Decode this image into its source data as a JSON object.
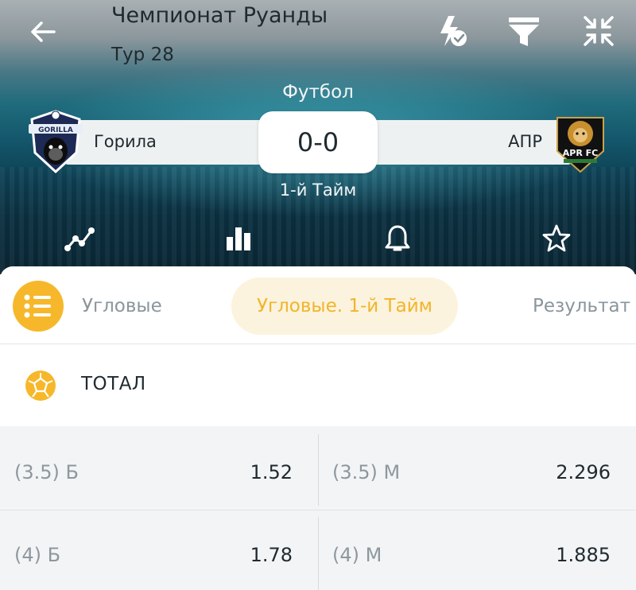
{
  "header": {
    "title": "Чемпионат Руанды",
    "subtitle": "Тур 28",
    "sport": "Футбол",
    "period": "1-й Тайм",
    "score": "0-0",
    "home_team": "Горила",
    "away_team": "АПР",
    "home_logo_text": "GORILLA",
    "away_logo_text": "APR FC"
  },
  "toolbar_icons": [
    "back-arrow-icon",
    "lightning-check-icon",
    "filter-icon",
    "collapse-icon"
  ],
  "nav_icons": [
    "trend-chart-icon",
    "bar-chart-icon",
    "bell-icon",
    "star-icon"
  ],
  "tabs": [
    {
      "label": "Угловые",
      "active": false
    },
    {
      "label": "Угловые. 1-й Тайм",
      "active": true
    },
    {
      "label": "Результат",
      "active": false
    }
  ],
  "section": {
    "title": "ТОТАЛ"
  },
  "odds": [
    {
      "label": "(3.5) Б",
      "value": "1.52"
    },
    {
      "label": "(3.5) М",
      "value": "2.296"
    },
    {
      "label": "(4) Б",
      "value": "1.78"
    },
    {
      "label": "(4) М",
      "value": "1.885"
    }
  ],
  "colors": {
    "accent": "#f6b82a",
    "active_tab_bg": "#fbf3dd",
    "active_tab_text": "#f2b42c",
    "text": "#1f2a30",
    "muted": "#8d989e"
  }
}
